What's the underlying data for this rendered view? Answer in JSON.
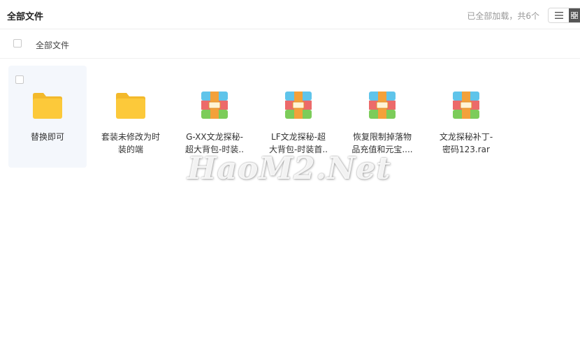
{
  "header": {
    "title": "全部文件",
    "status": "已全部加载，共6个"
  },
  "toolbar": {
    "select_all_label": "全部文件"
  },
  "files": [
    {
      "type": "folder",
      "name_lines": [
        "替换即可"
      ]
    },
    {
      "type": "folder",
      "name_lines": [
        "套装未修改为时",
        "装的端"
      ]
    },
    {
      "type": "archive",
      "name_lines": [
        "G-XX文龙探秘-",
        "超大背包-时装.."
      ]
    },
    {
      "type": "archive",
      "name_lines": [
        "LF文龙探秘-超",
        "大背包-时装首.."
      ]
    },
    {
      "type": "archive",
      "name_lines": [
        "恢复限制掉落物",
        "品充值和元宝...."
      ]
    },
    {
      "type": "archive",
      "name_lines": [
        "文龙探秘补丁-",
        "密码123.rar"
      ]
    }
  ],
  "watermark": "HaoM2.Net"
}
